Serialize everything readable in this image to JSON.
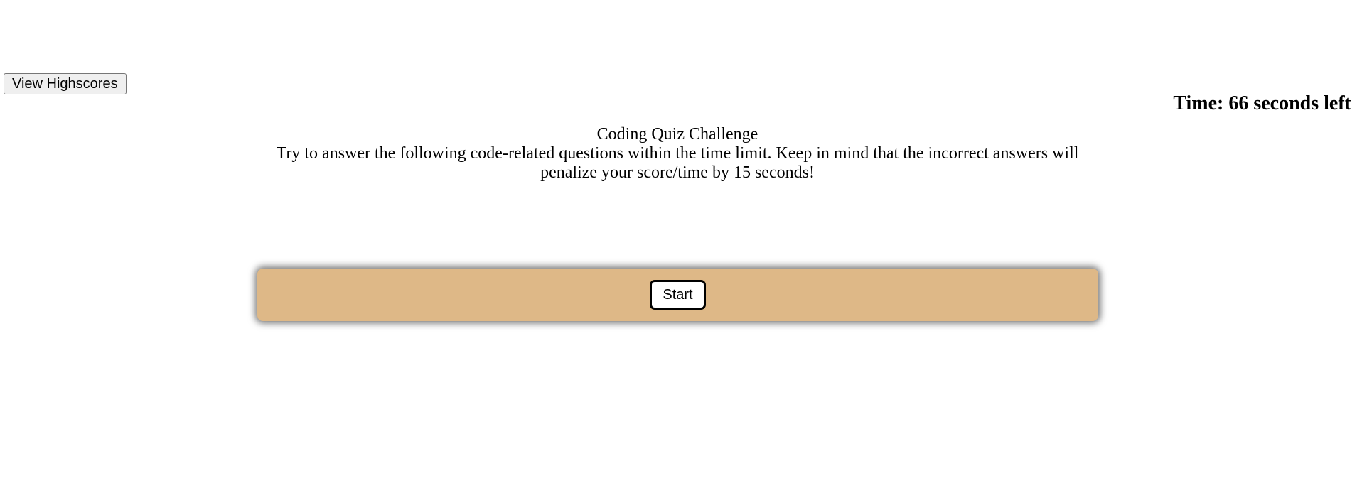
{
  "header": {
    "highscores_label": "View Highscores",
    "timer_text": "Time: 66 seconds left"
  },
  "intro": {
    "title": "Coding Quiz Challenge",
    "text": "Try to answer the following code-related questions within the time limit. Keep in mind that the incorrect answers will penalize your score/time by 15 seconds!"
  },
  "quiz": {
    "start_label": "Start",
    "panel_color": "#deb887"
  }
}
